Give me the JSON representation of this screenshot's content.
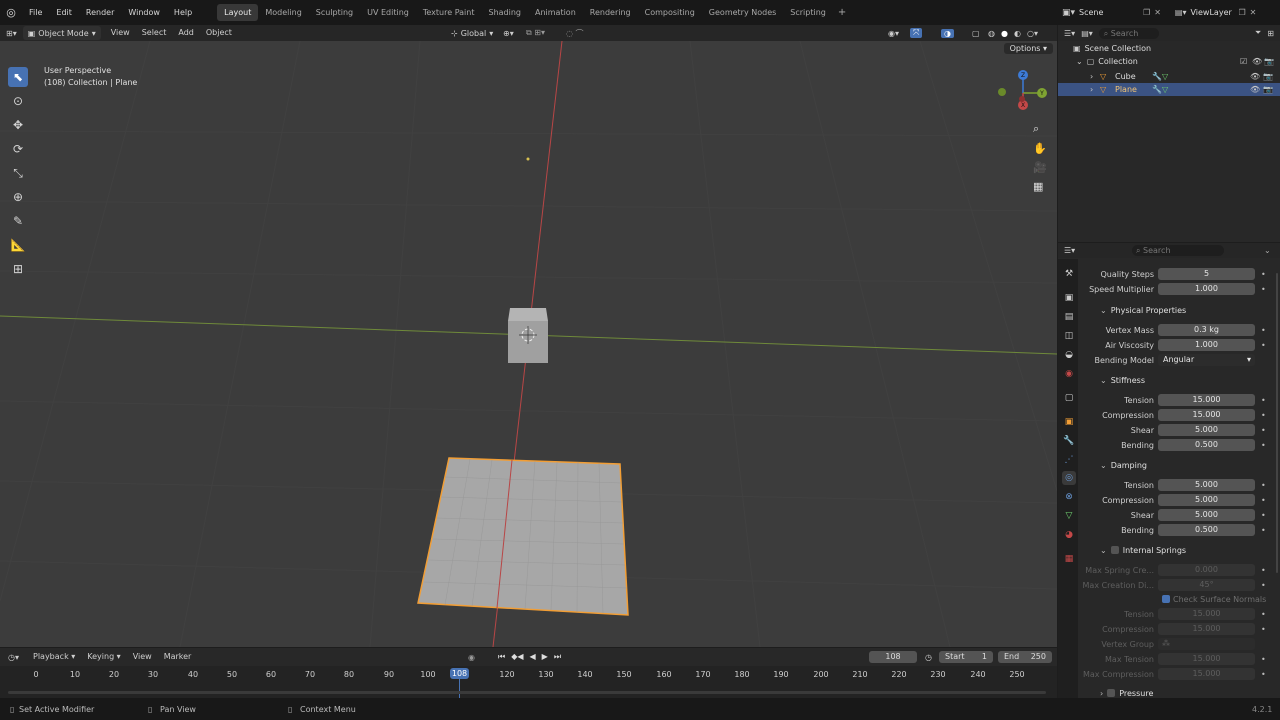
{
  "menu": {
    "items": [
      "File",
      "Edit",
      "Render",
      "Window",
      "Help"
    ]
  },
  "workspaces": [
    "Layout",
    "Modeling",
    "Sculpting",
    "UV Editing",
    "Texture Paint",
    "Shading",
    "Animation",
    "Rendering",
    "Compositing",
    "Geometry Nodes",
    "Scripting"
  ],
  "active_workspace": "Layout",
  "scene": {
    "name": "Scene",
    "view_layer": "ViewLayer"
  },
  "viewport_header": {
    "mode": "Object Mode",
    "menus": [
      "View",
      "Select",
      "Add",
      "Object"
    ],
    "orientation": "Global",
    "options": "Options"
  },
  "viewport": {
    "perspective": "User Perspective",
    "context": "(108) Collection | Plane"
  },
  "gizmo": {
    "x_label": "X",
    "y_label": "Y",
    "z_label": "Z"
  },
  "outliner": {
    "search_placeholder": "Search",
    "scene_collection": "Scene Collection",
    "collection": "Collection",
    "objects": [
      {
        "name": "Cube"
      },
      {
        "name": "Plane"
      }
    ]
  },
  "properties": {
    "search_placeholder": "Search",
    "top_rows": [
      {
        "label": "Quality Steps",
        "value": "5"
      },
      {
        "label": "Speed Multiplier",
        "value": "1.000"
      }
    ],
    "physical": {
      "title": "Physical Properties",
      "rows": [
        {
          "label": "Vertex Mass",
          "value": "0.3 kg"
        },
        {
          "label": "Air Viscosity",
          "value": "1.000"
        }
      ],
      "bending_model_label": "Bending Model",
      "bending_model_value": "Angular"
    },
    "stiffness": {
      "title": "Stiffness",
      "rows": [
        {
          "label": "Tension",
          "value": "15.000"
        },
        {
          "label": "Compression",
          "value": "15.000"
        },
        {
          "label": "Shear",
          "value": "5.000"
        },
        {
          "label": "Bending",
          "value": "0.500"
        }
      ]
    },
    "damping": {
      "title": "Damping",
      "rows": [
        {
          "label": "Tension",
          "value": "5.000"
        },
        {
          "label": "Compression",
          "value": "5.000"
        },
        {
          "label": "Shear",
          "value": "5.000"
        },
        {
          "label": "Bending",
          "value": "0.500"
        }
      ]
    },
    "internal_springs": {
      "title": "Internal Springs",
      "rows": [
        {
          "label": "Max Spring Cre...",
          "value": "0.000"
        },
        {
          "label": "Max Creation Di...",
          "value": "45°"
        }
      ],
      "check_normals": "Check Surface Normals",
      "rows2": [
        {
          "label": "Tension",
          "value": "15.000"
        },
        {
          "label": "Compression",
          "value": "15.000"
        }
      ],
      "vertex_group": "Vertex Group",
      "rows3": [
        {
          "label": "Max Tension",
          "value": "15.000"
        },
        {
          "label": "Max Compression",
          "value": "15.000"
        }
      ]
    },
    "pressure": "Pressure"
  },
  "timeline": {
    "menus": [
      "Playback",
      "Keying",
      "View",
      "Marker"
    ],
    "current_frame": "108",
    "start_label": "Start",
    "start": "1",
    "end_label": "End",
    "end": "250",
    "ticks": [
      "0",
      "10",
      "20",
      "30",
      "40",
      "50",
      "60",
      "70",
      "80",
      "90",
      "100",
      "120",
      "130",
      "140",
      "150",
      "160",
      "170",
      "180",
      "190",
      "200",
      "210",
      "220",
      "230",
      "240",
      "250"
    ],
    "playhead": "108"
  },
  "status_bar": {
    "left": "Set Active Modifier",
    "middle": "Pan View",
    "right": "Context Menu",
    "version": "4.2.1"
  },
  "colors": {
    "accent": "#4772b3",
    "selection_orange": "#f29e35",
    "x_axis": "#c44848",
    "y_axis": "#7fa332",
    "z_axis": "#3d7bd6"
  }
}
